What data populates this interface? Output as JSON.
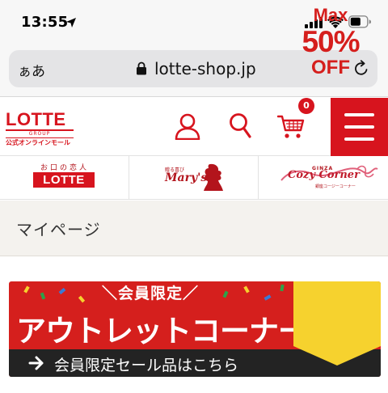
{
  "status_bar": {
    "time": "13:55",
    "icons": [
      "location-arrow-icon",
      "signal-icon",
      "wifi-icon",
      "battery-icon"
    ]
  },
  "address_bar": {
    "reader_label": "ぁあ",
    "url": "lotte-shop.jp",
    "icons": [
      "lock-icon",
      "reload-icon"
    ]
  },
  "header": {
    "logo_text": "LOTTE",
    "logo_group": "GROUP",
    "logo_sub": "公式オンラインモール",
    "cart_count": "0",
    "icons": [
      "user-icon",
      "search-icon",
      "cart-icon",
      "hamburger-menu-icon"
    ],
    "accent_color": "#d7141e"
  },
  "brands": [
    {
      "id": "koibito",
      "tagline": "お口の恋人",
      "name": "LOTTE"
    },
    {
      "id": "marys",
      "tagline": "贈る喜び",
      "name": "Mary's"
    },
    {
      "id": "cozy",
      "tagline": "GINZA",
      "name": "Cozy Corner",
      "sub": "銀座コージーコーナー"
    }
  ],
  "page_title": "マイページ",
  "banner": {
    "sub_title": "＼会員限定／",
    "main_title": "アウトレットコーナー",
    "bottom_text": "会員限定セール品はこちら",
    "badge_max": "Max",
    "badge_percent": "50%",
    "badge_off": "OFF",
    "colors": {
      "red": "#d51f1d",
      "yellow": "#f6d22e",
      "dark": "#232323"
    }
  }
}
